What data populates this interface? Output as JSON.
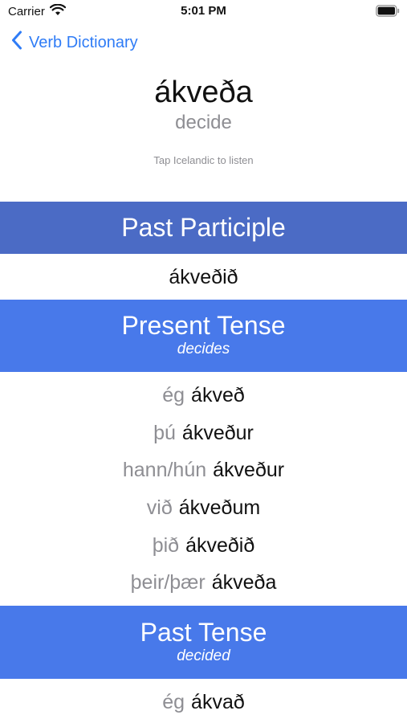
{
  "status_bar": {
    "carrier": "Carrier",
    "time": "5:01 PM",
    "icons": [
      "wifi-icon",
      "battery-icon"
    ]
  },
  "nav": {
    "back_label": "Verb Dictionary",
    "back_icon": "chevron-left-icon",
    "accent_color": "#2f7cf6"
  },
  "verb": {
    "icelandic": "ákveða",
    "english": "decide",
    "hint": "Tap Icelandic to listen"
  },
  "colors": {
    "past_participle_header": "#4b6bc5",
    "present_header": "#4879ea",
    "past_header": "#4879ea",
    "pronoun_text": "#8e8e93"
  },
  "past_participle": {
    "title": "Past Participle",
    "form": "ákveðið"
  },
  "present_tense": {
    "title": "Present Tense",
    "subtitle": "decides",
    "rows": [
      {
        "pronoun": "ég",
        "form": "ákveð"
      },
      {
        "pronoun": "þú",
        "form": "ákveður"
      },
      {
        "pronoun": "hann/hún",
        "form": "ákveður"
      },
      {
        "pronoun": "við",
        "form": "ákveðum"
      },
      {
        "pronoun": "þið",
        "form": "ákveðið"
      },
      {
        "pronoun": "þeir/þær",
        "form": "ákveða"
      }
    ]
  },
  "past_tense": {
    "title": "Past Tense",
    "subtitle": "decided",
    "rows": [
      {
        "pronoun": "ég",
        "form": "ákvað"
      }
    ]
  }
}
